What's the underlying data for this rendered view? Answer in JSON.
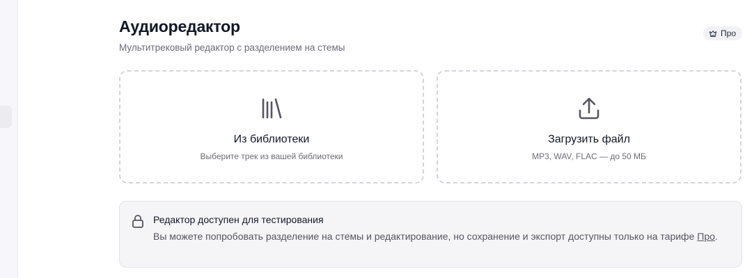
{
  "page": {
    "title": "Аудиоредактор",
    "subtitle": "Мультитрековый редактор с разделением на стемы"
  },
  "badge": {
    "label": "Про",
    "icon": "crown-icon"
  },
  "cards": {
    "library": {
      "icon": "library-icon",
      "title": "Из библиотеки",
      "description": "Выберите трек из вашей библиотеки"
    },
    "upload": {
      "icon": "upload-icon",
      "title": "Загрузить файл",
      "description": "MP3, WAV, FLAC — до 50 МБ"
    }
  },
  "notice": {
    "icon": "lock-icon",
    "title": "Редактор доступен для тестирования",
    "text_before": "Вы можете попробовать разделение на стемы и редактирование, но сохранение и экспорт доступны только на тарифе ",
    "link_label": "Про",
    "text_after": "."
  },
  "colors": {
    "card_border": "#d4d4dc",
    "icon": "#55555f",
    "notice_bg": "#f5f5f7"
  }
}
